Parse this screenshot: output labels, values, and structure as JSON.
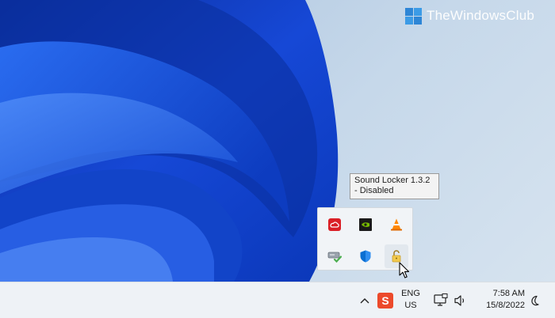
{
  "watermark": {
    "text": "TheWindowsClub"
  },
  "tooltip": {
    "line1": "Sound Locker 1.3.2",
    "line2": "- Disabled"
  },
  "overflow_tray": {
    "icons": [
      {
        "icon": "adobe-creative-cloud-icon",
        "color": "#da1f26"
      },
      {
        "icon": "nvidia-icon",
        "color": "#76b900"
      },
      {
        "icon": "vlc-icon",
        "color": "#ff8800"
      },
      {
        "icon": "drive-check-icon",
        "color": "#4caf50"
      },
      {
        "icon": "windows-security-icon",
        "color": "#0078d4"
      },
      {
        "icon": "padlock-open-icon",
        "color": "#e0b030"
      }
    ]
  },
  "taskbar": {
    "language": {
      "line1": "ENG",
      "line2": "US"
    },
    "clock": {
      "time": "7:58 AM",
      "date": "15/8/2022"
    },
    "icons": [
      "chevron-up-icon",
      "sogou-ime-icon",
      "network-icon",
      "volume-icon",
      "focus-moon-icon"
    ],
    "ime_label": "S"
  },
  "colors": {
    "wallpaper_blue": "#0a3fc4",
    "ime_red": "#ec4a2b"
  }
}
